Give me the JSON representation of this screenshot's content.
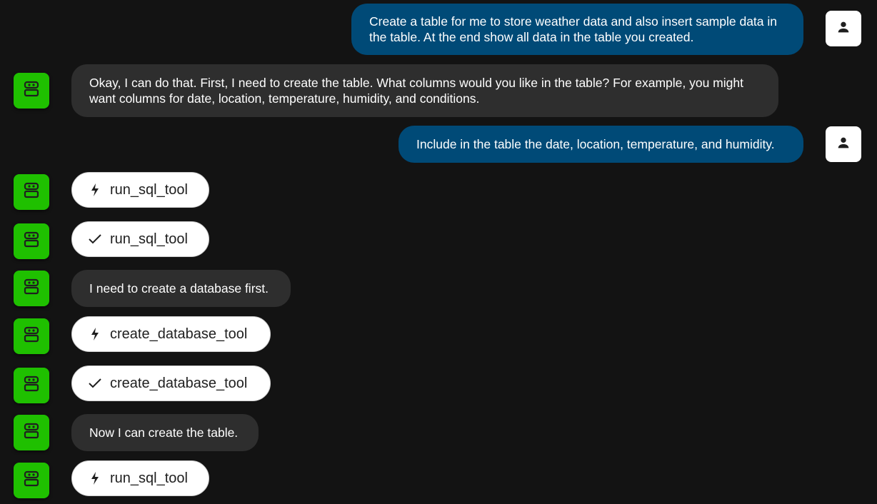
{
  "colors": {
    "background": "#131313",
    "user_bubble": "#004a77",
    "bot_bubble": "#2e2e2e",
    "bot_avatar": "#1fc000",
    "user_avatar": "#ffffff",
    "chip": "#ffffff"
  },
  "messages": [
    {
      "role": "user",
      "kind": "text",
      "text": "Create a table for me to store weather data and also insert sample data in the table. At the end show all data in the table you created.",
      "avatar_icon": "person-icon"
    },
    {
      "role": "bot",
      "kind": "text",
      "text": "Okay, I can do that. First, I need to create the table. What columns would you like in the table? For example, you might want columns for date, location, temperature, humidity, and conditions.",
      "avatar_icon": "robot-icon"
    },
    {
      "role": "user",
      "kind": "text",
      "text": "Include in the table the date, location, temperature, and humidity.",
      "avatar_icon": "person-icon"
    },
    {
      "role": "bot",
      "kind": "tool_call",
      "tool": "run_sql_tool",
      "status_icon": "bolt-icon"
    },
    {
      "role": "bot",
      "kind": "tool_result",
      "tool": "run_sql_tool",
      "status_icon": "check-icon"
    },
    {
      "role": "bot",
      "kind": "text",
      "text": "I need to create a database first."
    },
    {
      "role": "bot",
      "kind": "tool_call",
      "tool": "create_database_tool",
      "status_icon": "bolt-icon"
    },
    {
      "role": "bot",
      "kind": "tool_result",
      "tool": "create_database_tool",
      "status_icon": "check-icon"
    },
    {
      "role": "bot",
      "kind": "text",
      "text": "Now I can create the table."
    },
    {
      "role": "bot",
      "kind": "tool_call",
      "tool": "run_sql_tool",
      "status_icon": "bolt-icon"
    }
  ]
}
